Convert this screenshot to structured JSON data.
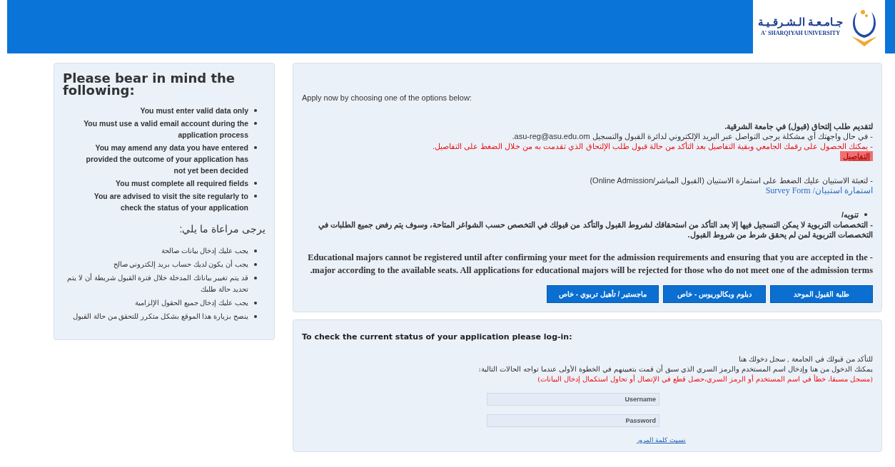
{
  "header": {
    "logo_arabic": "جـامـعـة الـشـرقـيـة",
    "logo_english": "A' SHARQIYAH UNIVERSITY"
  },
  "notes": {
    "title": "Please bear in mind the following:",
    "items_en": [
      "You must enter valid data only",
      "You must use a valid email account during the application process",
      "You may amend any data you have entered provided the outcome of your application has not yet been decided",
      "You must complete all required fields",
      "You are advised to visit the site regularly to check the status of your application"
    ],
    "title_ar": "يرجى مراعاة ما يلي:",
    "items_ar": [
      "يجب عليك إدخال بيانات صالحة",
      "يجب أن يكون لديك حساب بريد إلكتروني صالح",
      "قد يتم تغيير بياناتك المدخلة خلال فترة القبول شريطة أن لا يتم تحديد حالة طلبك",
      "يجب عليك إدخال جميع الحقول الإلزامية",
      "ينصح بزيارة هذا الموقع بشكل متكرر للتحقق من حالة القبول"
    ]
  },
  "apply": {
    "intro": "Apply now by choosing one of the options below:",
    "heading_ar": "لتقديم طلب إلتحاق (قبول) في جامعة الشرقية.",
    "contact_ar": "- في حال واجهتك أي مشكلة يرجى التواصل عبر البريد الإلكتروني لدائرة القبول والتسجيل asu-reg@asu.edu.om.",
    "notice_red_ar": "- يمكنك الحصول على رقمك الجامعي وبقية التفاصيل بعد التأكد من حالة قبول طلب الإلتحاق الذي تقدمت به من خلال الضغط على التفاصيل.",
    "details_link": "التفاصيل",
    "survey_ar": "- لتعبئة الاستبيان عليك الضغط على استمارة الاستبيان (القبول المباشر/Online Admission)",
    "survey_link": "استمارة استبيان/ Survey Form",
    "alert_title": "تنويه/",
    "alert_ar": "- التخصصات التربوية لا يمكن التسجيل فيها إلا بعد التأكد من استحقاقك لشروط القبول والتأكد من قبولك في التخصص حسب الشواغر المتاحة، وسوف يتم رفض جميع الطلبات في التخصصات التربوية لمن لم يحقق شرط من شروط القبول.",
    "alert_en": "- Educational majors cannot be registered until after confirming your meet for the admission requirements and ensuring that you are accepted in the major according to the available seats. All applications for educational majors will be rejected for those who do not meet one of the admission terms.",
    "buttons": [
      "طلبة القبول الموحد",
      "دبلوم وبكالوريوس - خاص",
      "ماجستير / تأهيل تربوي - خاص"
    ]
  },
  "login": {
    "title": "To check the current status of your application please log-in:",
    "line1_ar": "للتأكد من قبولك في الجامعة , سجل دخولك هنا",
    "line2_ar": "يمكنك الدخول من هنا وإدخال اسم المستخدم والرمز السري الذي سبق أن قمت بتعيينهم في الخطوة الأولى عندما تواجه الحالات التالية:",
    "line3_red_ar": "(مسجل مسبقا، خطأ في اسم المستخدم أو الرمز السري،حصل قطع في الإتصال أو تحاول استكمال إدخال البيانات)",
    "username": {
      "placeholder": "Username"
    },
    "password": {
      "placeholder": "Password"
    },
    "forgot_link": "نسيت كلمة المرور"
  }
}
